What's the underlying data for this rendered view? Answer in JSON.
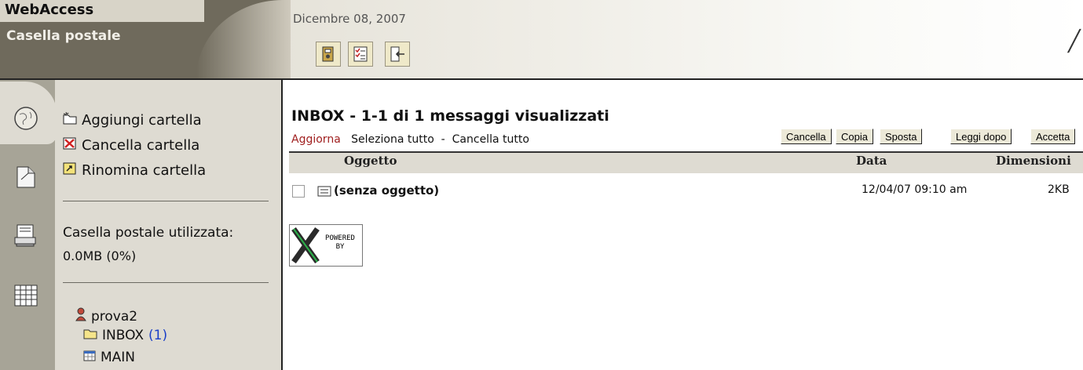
{
  "app": {
    "title": "WebAccess",
    "section": "Casella postale",
    "date": "Dicembre 08, 2007"
  },
  "toolbar": {
    "icons": [
      "address-book-icon",
      "checklist-icon",
      "logout-icon"
    ]
  },
  "rail": {
    "icons": [
      "globe-icon",
      "document-icon",
      "print-stack-icon",
      "calendar-grid-icon"
    ]
  },
  "sidebar": {
    "actions": [
      {
        "label": "Aggiungi cartella",
        "icon": "new-folder-icon"
      },
      {
        "label": "Cancella cartella",
        "icon": "delete-folder-icon"
      },
      {
        "label": "Rinomina cartella",
        "icon": "rename-folder-icon"
      }
    ],
    "usage_label": "Casella postale utilizzata:",
    "usage_value": "0.0MB  (0%)",
    "tree": {
      "user": "prova2",
      "folders": [
        {
          "name": "INBOX",
          "count": "(1)"
        },
        {
          "name": "MAIN",
          "count": ""
        }
      ]
    }
  },
  "main": {
    "title": "INBOX - 1-1 di 1 messaggi visualizzati",
    "links": {
      "refresh": "Aggiorna",
      "select_all": "Seleziona tutto",
      "separator": "-",
      "clear_all": "Cancella tutto"
    },
    "buttons": [
      "Cancella",
      "Copia",
      "Sposta",
      "Leggi dopo",
      "Accetta"
    ],
    "columns": {
      "subject": "Oggetto",
      "date": "Data",
      "size": "Dimensioni"
    },
    "messages": [
      {
        "subject": "(senza oggetto)",
        "date": "12/04/07  09:10 am",
        "size": "2KB"
      }
    ],
    "powered": {
      "line1": "POWERED",
      "line2": "BY"
    }
  },
  "colors": {
    "accent_red": "#a02020",
    "count_blue": "#1a3fc8",
    "brand_dark": "#6f6a5c"
  }
}
